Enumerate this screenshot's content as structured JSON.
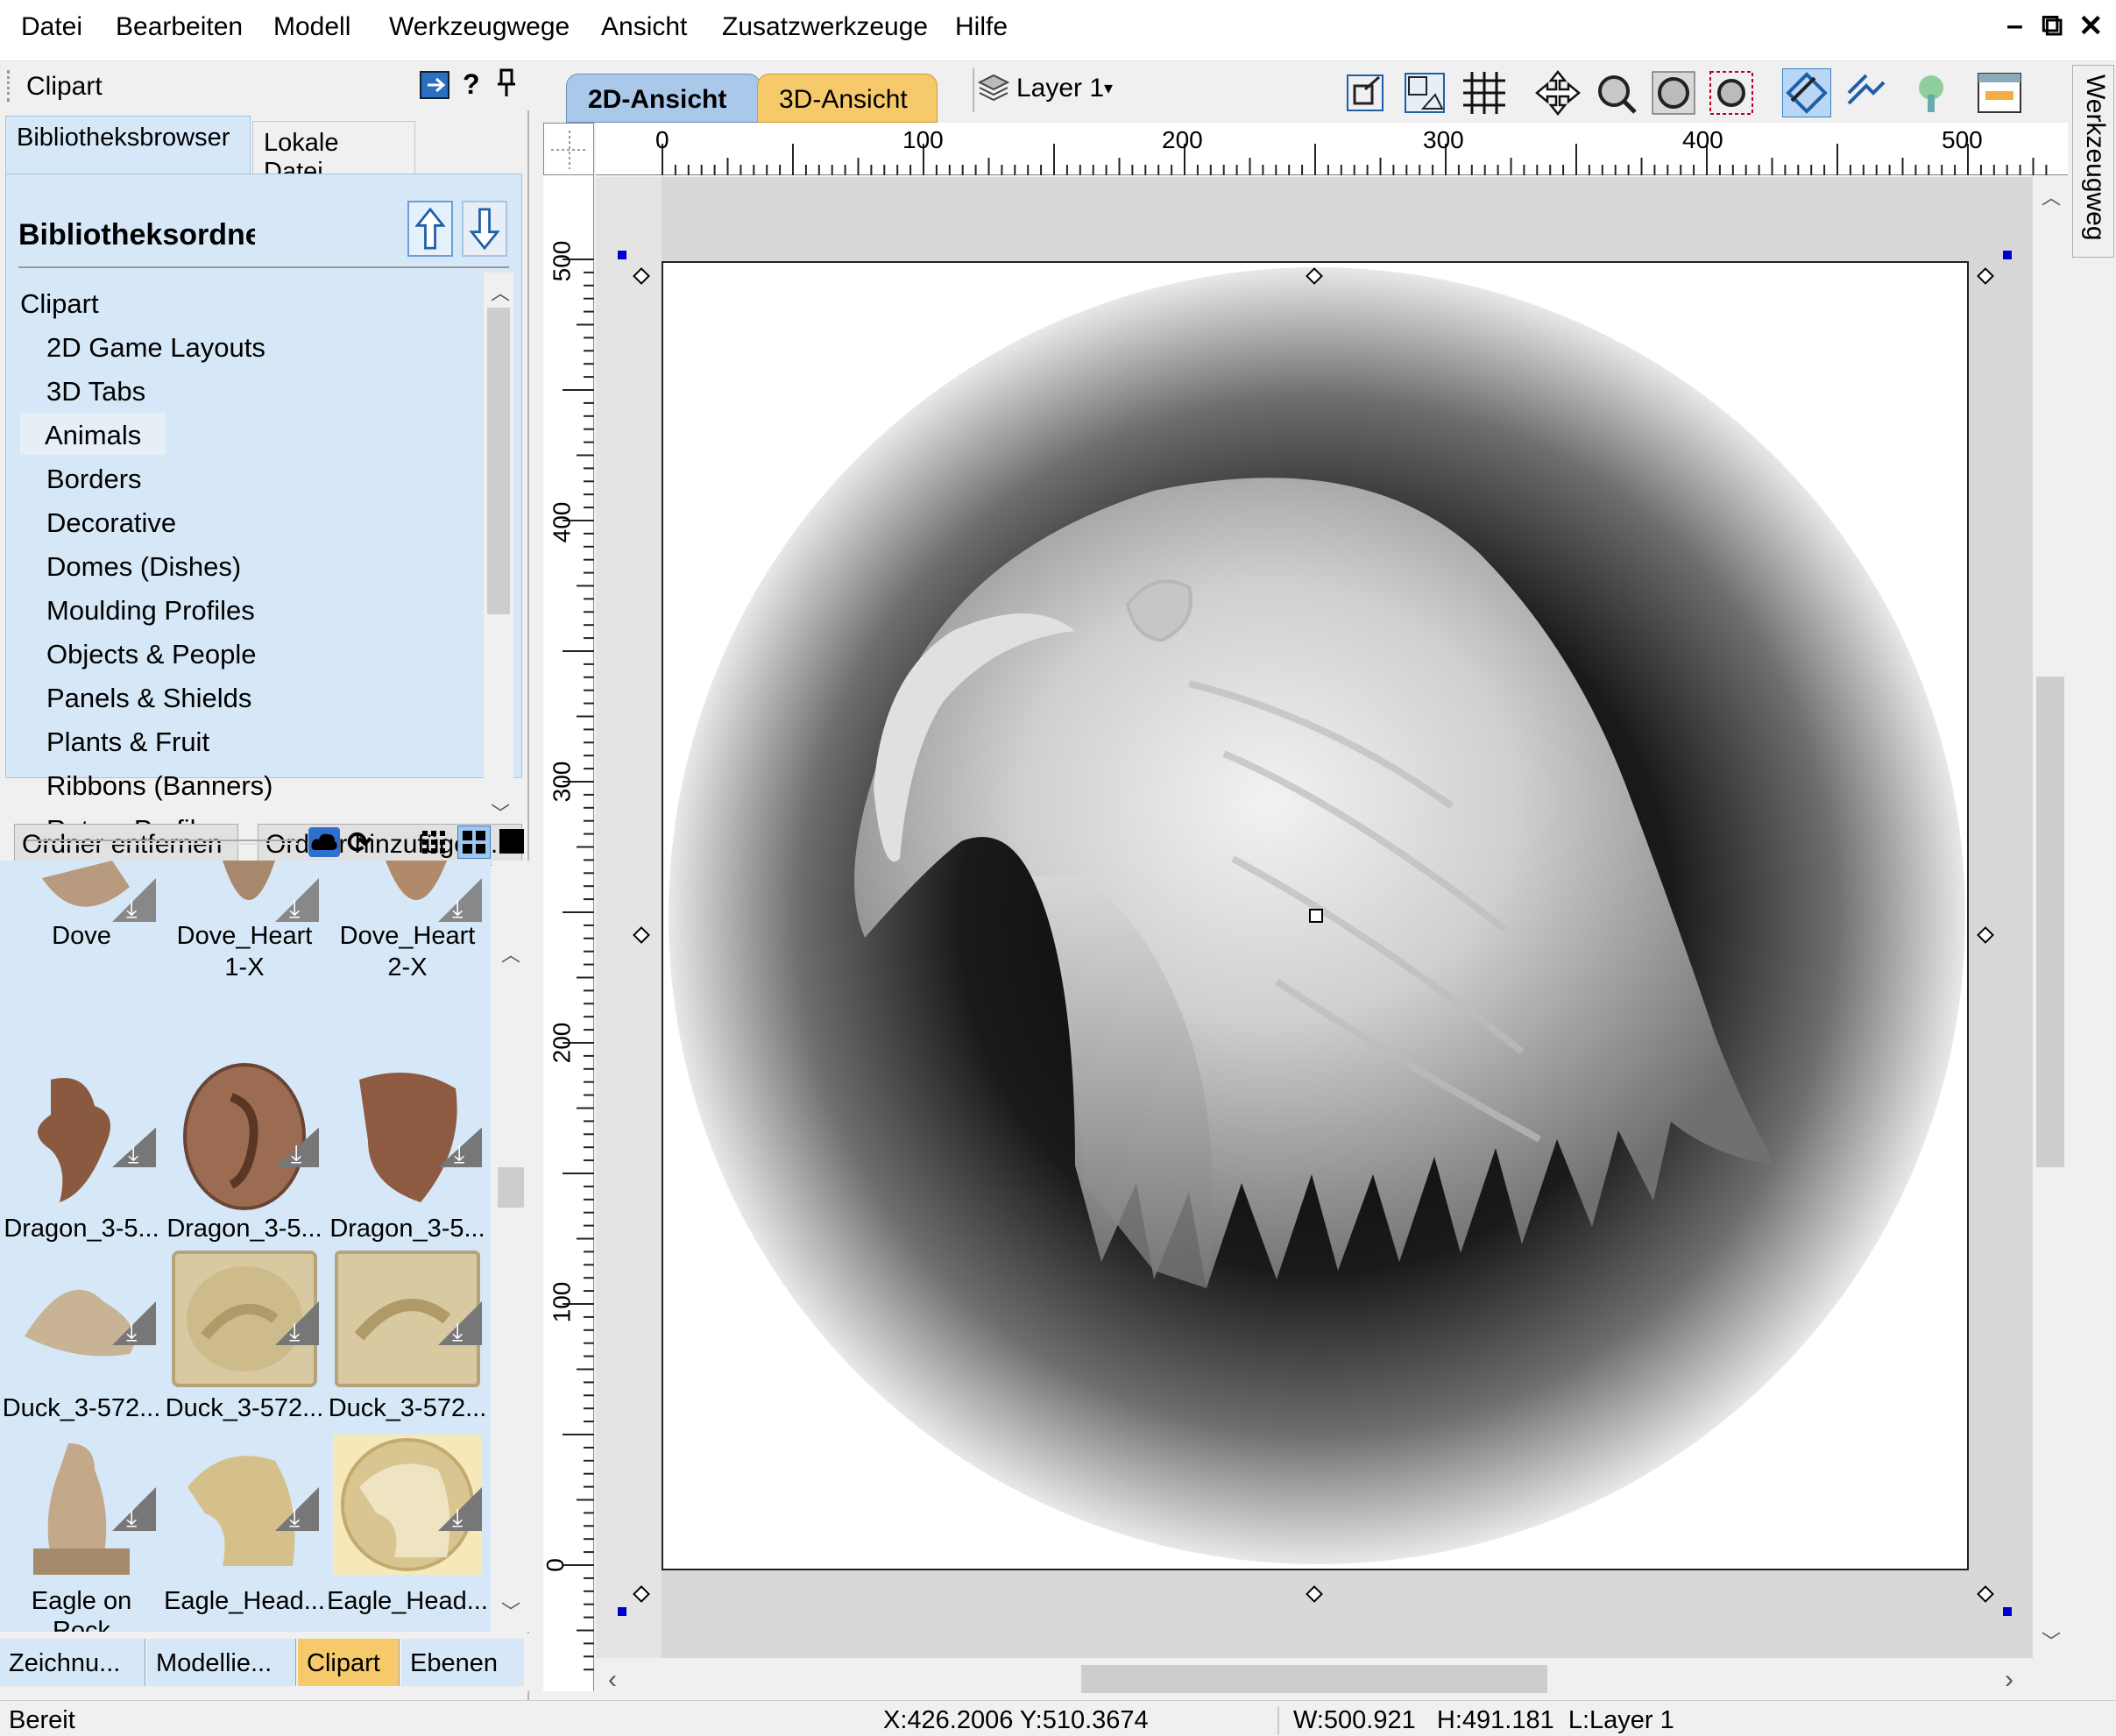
{
  "menu": [
    "Datei",
    "Bearbeiten",
    "Modell",
    "Werkzeugwege",
    "Ansicht",
    "Zusatzwerkzeuge",
    "Hilfe"
  ],
  "window_controls": {
    "minimize": "–",
    "restore": "⧉",
    "close": "✕"
  },
  "panel": {
    "title": "Clipart",
    "help": "?",
    "pin": "📌",
    "tabs": [
      "Bibliotheksbrowser",
      "Lokale Datei"
    ],
    "header": "Bibliotheksordner",
    "folders": [
      "Clipart",
      "2D Game Layouts",
      "3D Tabs",
      "Animals",
      "Borders",
      "Decorative",
      "Domes (Dishes)",
      "Moulding Profiles",
      "Objects & People",
      "Panels & Shields",
      "Plants & Fruit",
      "Ribbons (Banners)",
      "Rotary Profiles"
    ],
    "selected_folder": "Animals",
    "buttons": {
      "remove": "Ordner entfernen",
      "add": "Ordner hinzufügen..."
    }
  },
  "gallery": {
    "items": [
      {
        "caption": "Dove",
        "caption2": ""
      },
      {
        "caption": "Dove_Heart",
        "caption2": "1-X"
      },
      {
        "caption": "Dove_Heart",
        "caption2": "2-X"
      },
      {
        "caption": "Dragon_3-5...",
        "caption2": ""
      },
      {
        "caption": "Dragon_3-5...",
        "caption2": ""
      },
      {
        "caption": "Dragon_3-5...",
        "caption2": ""
      },
      {
        "caption": "Duck_3-572...",
        "caption2": ""
      },
      {
        "caption": "Duck_3-572...",
        "caption2": ""
      },
      {
        "caption": "Duck_3-572...",
        "caption2": ""
      },
      {
        "caption": "Eagle on",
        "caption2": "Rock"
      },
      {
        "caption": "Eagle_Head...",
        "caption2": ""
      },
      {
        "caption": "Eagle_Head...",
        "caption2": ""
      }
    ]
  },
  "bottom_tabs": [
    "Zeichnu...",
    "Modellie...",
    "Clipart",
    "Ebenen"
  ],
  "active_bottom_tab": "Clipart",
  "view": {
    "tabs": [
      "2D-Ansicht",
      "3D-Ansicht"
    ],
    "layer": "Layer 1",
    "side_tab": "Werkzeugweg",
    "ruler_top": [
      "0",
      "100",
      "200",
      "300",
      "400",
      "500"
    ],
    "ruler_left": [
      "500",
      "400",
      "300",
      "200",
      "100",
      "0"
    ]
  },
  "status": {
    "ready": "Bereit",
    "coords": "X:426.2006 Y:510.3674",
    "dims": "W:500.921   H:491.181  L:Layer 1"
  },
  "colors": {
    "accent_blue": "#d6e8f7",
    "active_tab": "#f6c96a",
    "selected_handle": "#0000cc"
  }
}
